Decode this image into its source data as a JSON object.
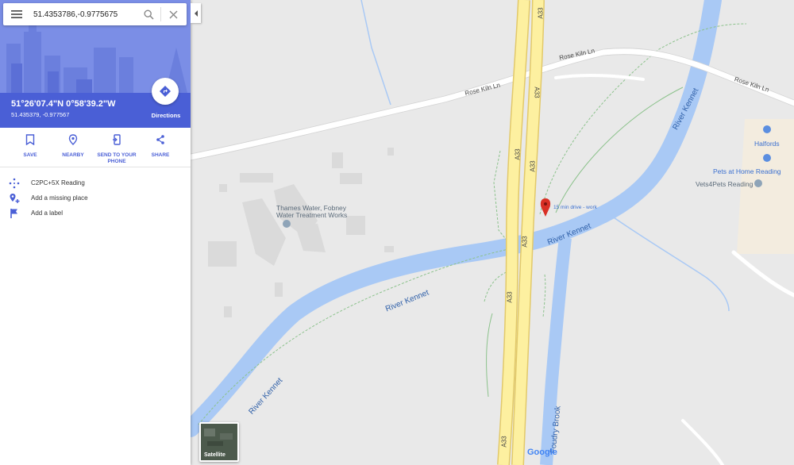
{
  "search": {
    "value": "51.4353786,-0.9775675"
  },
  "place": {
    "title": "51°26'07.4\"N 0°58'39.2\"W",
    "subtitle": "51.435379, -0.977567",
    "directions_label": "Directions"
  },
  "actions": [
    {
      "label": "SAVE",
      "icon": "bookmark-icon"
    },
    {
      "label": "NEARBY",
      "icon": "nearby-pin-icon"
    },
    {
      "label": "SEND TO YOUR PHONE",
      "icon": "send-to-phone-icon"
    },
    {
      "label": "SHARE",
      "icon": "share-icon"
    }
  ],
  "details": [
    {
      "text": "C2PC+5X Reading",
      "icon": "plus-code-icon"
    },
    {
      "text": "Add a missing place",
      "icon": "add-place-icon"
    },
    {
      "text": "Add a label",
      "icon": "flag-icon"
    }
  ],
  "map": {
    "labels": {
      "rose_kiln_1": "Rose Kiln Ln",
      "rose_kiln_2": "Rose Kiln Ln",
      "rose_kiln_3": "Rose Kiln Ln",
      "a33_1": "A33",
      "a33_2": "A33",
      "a33_3": "A33",
      "a33_4": "A33",
      "a33_5": "A33",
      "a33_6": "A33",
      "river_1": "River Kennet",
      "river_2": "River Kennet",
      "river_3": "River Kennet",
      "river_4": "River Kennet",
      "foudry": "Foudry Brook",
      "thames_1": "Thames Water, Fobney",
      "thames_2": "Water Treatment Works",
      "halfords": "Halfords",
      "pets_home": "Pets at Home Reading",
      "vets4pets": "Vets4Pets Reading"
    },
    "marker_label": "15 min drive - work",
    "satellite_label": "Satellite",
    "google_logo": "Google"
  },
  "colors": {
    "accent": "#4a5fd6",
    "river": "#a9c9f5",
    "highway": "#fdf0a0",
    "marker": "#d93025"
  }
}
